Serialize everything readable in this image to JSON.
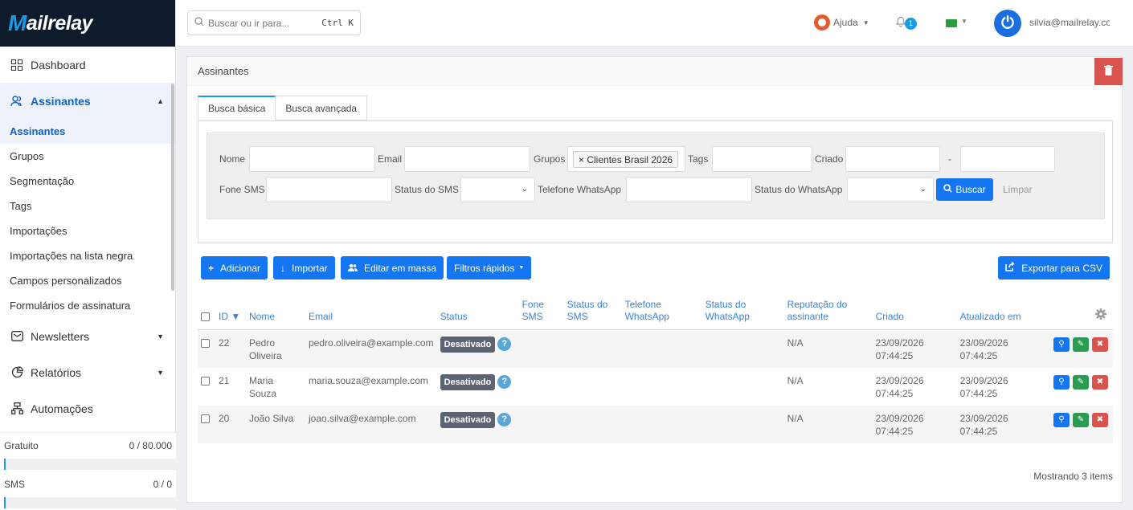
{
  "brand": {
    "logo_m": "M",
    "logo_rest": "ailrelay"
  },
  "sidebar": {
    "dashboard": "Dashboard",
    "assinantes": "Assinantes",
    "sub_items": [
      "Assinantes",
      "Grupos",
      "Segmentação",
      "Tags",
      "Importações",
      "Importações na lista negra",
      "Campos personalizados",
      "Formulários de assinatura"
    ],
    "newsletters": "Newsletters",
    "relatorios": "Relatórios",
    "automacoes": "Automações"
  },
  "plans": [
    {
      "label": "Gratuito",
      "usage": "0 / 80.000",
      "fill_percent": 1
    },
    {
      "label": "SMS",
      "usage": "0 / 0",
      "fill_percent": 1
    }
  ],
  "topbar": {
    "search_placeholder": "Buscar ou ir para...",
    "search_shortcut": "Ctrl K",
    "help": "Ajuda",
    "notifications": "1",
    "avatar_letter": "⏻",
    "user_email": "silvia@mailrelay.co"
  },
  "card": {
    "title": "Assinantes",
    "tabs": [
      "Busca básica",
      "Busca avançada"
    ]
  },
  "filters": {
    "nome": "Nome",
    "email": "Email",
    "grupos": "Grupos",
    "grupos_chip": "× Clientes Brasil 2026",
    "tags": "Tags",
    "criado": "Criado",
    "range_sep": "-",
    "fone_sms": "Fone SMS",
    "status_sms": "Status do SMS",
    "telefone_whatsapp": "Telefone WhatsApp",
    "status_whatsapp": "Status do WhatsApp",
    "buscar": "Buscar",
    "limpar": "Limpar"
  },
  "actions": {
    "adicionar": "Adicionar",
    "importar": "Importar",
    "editar_massa": "Editar em massa",
    "filtros_rapidos": "Filtros rápidos",
    "exportar_csv": "Exportar para CSV"
  },
  "table": {
    "headers": {
      "id": "ID ▼",
      "nome": "Nome",
      "email": "Email",
      "status": "Status",
      "fone_sms": "Fone SMS",
      "status_sms": "Status do SMS",
      "telefone_whatsapp": "Telefone WhatsApp",
      "status_whatsapp": "Status do WhatsApp",
      "reputacao": "Reputação do assinante",
      "criado": "Criado",
      "atualizado": "Atualizado em"
    },
    "rows": [
      {
        "id": "22",
        "nome": "Pedro Oliveira",
        "email": "pedro.oliveira@example.com",
        "status": "Desativado",
        "reputacao": "N/A",
        "criado": "23/09/2026 07:44:25",
        "atualizado": "23/09/2026 07:44:25"
      },
      {
        "id": "21",
        "nome": "Maria Souza",
        "email": "maria.souza@example.com",
        "status": "Desativado",
        "reputacao": "N/A",
        "criado": "23/09/2026 07:44:25",
        "atualizado": "23/09/2026 07:44:25"
      },
      {
        "id": "20",
        "nome": "João Silva",
        "email": "joao.silva@example.com",
        "status": "Desativado",
        "reputacao": "N/A",
        "criado": "23/09/2026 07:44:25",
        "atualizado": "23/09/2026 07:44:25"
      }
    ],
    "footer": "Mostrando 3 items"
  },
  "colors": {
    "primary": "#1576f2",
    "danger": "#d9534f",
    "success": "#2a9d52",
    "sidebar_dark": "#0d1b2a"
  }
}
